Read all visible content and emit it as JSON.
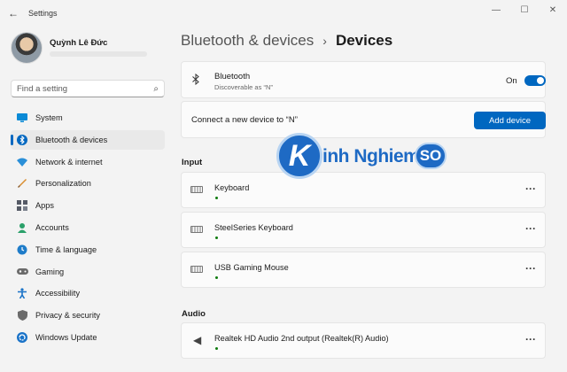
{
  "window": {
    "title": "Settings",
    "back_icon": "arrow-left-icon",
    "controls": [
      "—",
      "☐",
      "✕"
    ]
  },
  "profile": {
    "name": "Quỳnh Lê Đức"
  },
  "search": {
    "placeholder": "Find a setting"
  },
  "sidebar": {
    "items": [
      {
        "label": "System",
        "icon": "monitor-icon",
        "color": "#0a8ad6"
      },
      {
        "label": "Bluetooth & devices",
        "icon": "bluetooth-icon",
        "color": "#0067c0",
        "active": true
      },
      {
        "label": "Network & internet",
        "icon": "wifi-icon",
        "color": "#2a8fd8"
      },
      {
        "label": "Personalization",
        "icon": "brush-icon",
        "color": "#d98b2b"
      },
      {
        "label": "Apps",
        "icon": "apps-icon",
        "color": "#555a66"
      },
      {
        "label": "Accounts",
        "icon": "person-icon",
        "color": "#2aa06a"
      },
      {
        "label": "Time & language",
        "icon": "globe-clock-icon",
        "color": "#1e7cc9"
      },
      {
        "label": "Gaming",
        "icon": "gamepad-icon",
        "color": "#6b6b6b"
      },
      {
        "label": "Accessibility",
        "icon": "accessibility-icon",
        "color": "#1a73c8"
      },
      {
        "label": "Privacy & security",
        "icon": "shield-icon",
        "color": "#6b6b6b"
      },
      {
        "label": "Windows Update",
        "icon": "update-icon",
        "color": "#1a73c8"
      }
    ]
  },
  "breadcrumb": {
    "parent": "Bluetooth & devices",
    "separator": "›",
    "current": "Devices"
  },
  "bluetooth": {
    "title": "Bluetooth",
    "subtitle": "Discoverable as “N”",
    "state": "On"
  },
  "connect": {
    "text": "Connect a new device to “N”",
    "button": "Add device"
  },
  "sections": {
    "input": "Input",
    "audio": "Audio"
  },
  "input_devices": [
    {
      "name": "Keyboard"
    },
    {
      "name": "SteelSeries Keyboard"
    },
    {
      "name": "USB Gaming Mouse"
    }
  ],
  "audio_devices": [
    {
      "name": "Realtek HD Audio 2nd output (Realtek(R) Audio)"
    }
  ],
  "more_label": "···",
  "watermark": {
    "letter": "K",
    "text": "inh Nghiem",
    "badge": "SO"
  },
  "colors": {
    "accent": "#0067c0",
    "connected": "#0f7b0f"
  }
}
